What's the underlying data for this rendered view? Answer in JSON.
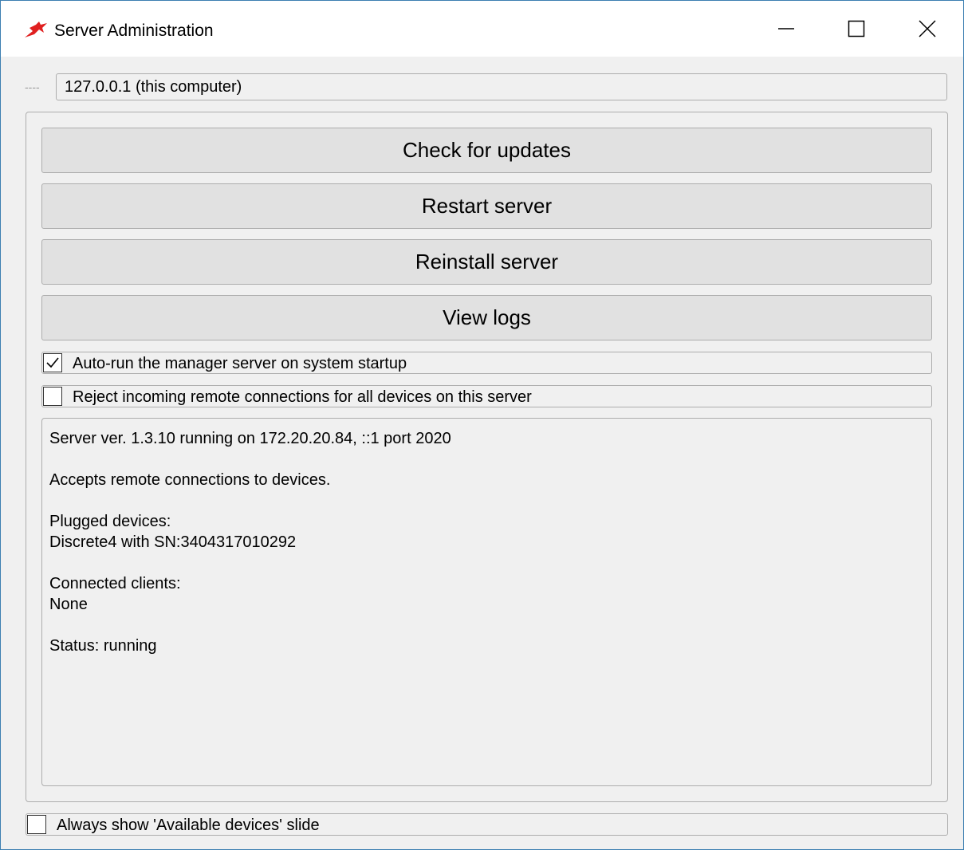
{
  "window": {
    "title": "Server Administration",
    "accent_color": "#e02020"
  },
  "address": {
    "prefix": "----",
    "value": "127.0.0.1 (this computer)"
  },
  "actions": {
    "check_updates": "Check for updates",
    "restart": "Restart server",
    "reinstall": "Reinstall server",
    "view_logs": "View logs"
  },
  "options": {
    "autorun": {
      "label": "Auto-run the manager server on system startup",
      "checked": true
    },
    "reject": {
      "label": "Reject incoming remote connections for all devices on this server",
      "checked": false
    },
    "always_show": {
      "label": "Always show 'Available devices' slide",
      "checked": false
    }
  },
  "info": {
    "server_line": "Server ver. 1.3.10 running on 172.20.20.84, ::1 port 2020",
    "accepts_line": "Accepts remote connections to devices.",
    "plugged_heading": "Plugged devices:",
    "plugged_device": "Discrete4 with SN:3404317010292",
    "clients_heading": "Connected clients:",
    "clients_value": "None",
    "status_line": "Status: running"
  }
}
